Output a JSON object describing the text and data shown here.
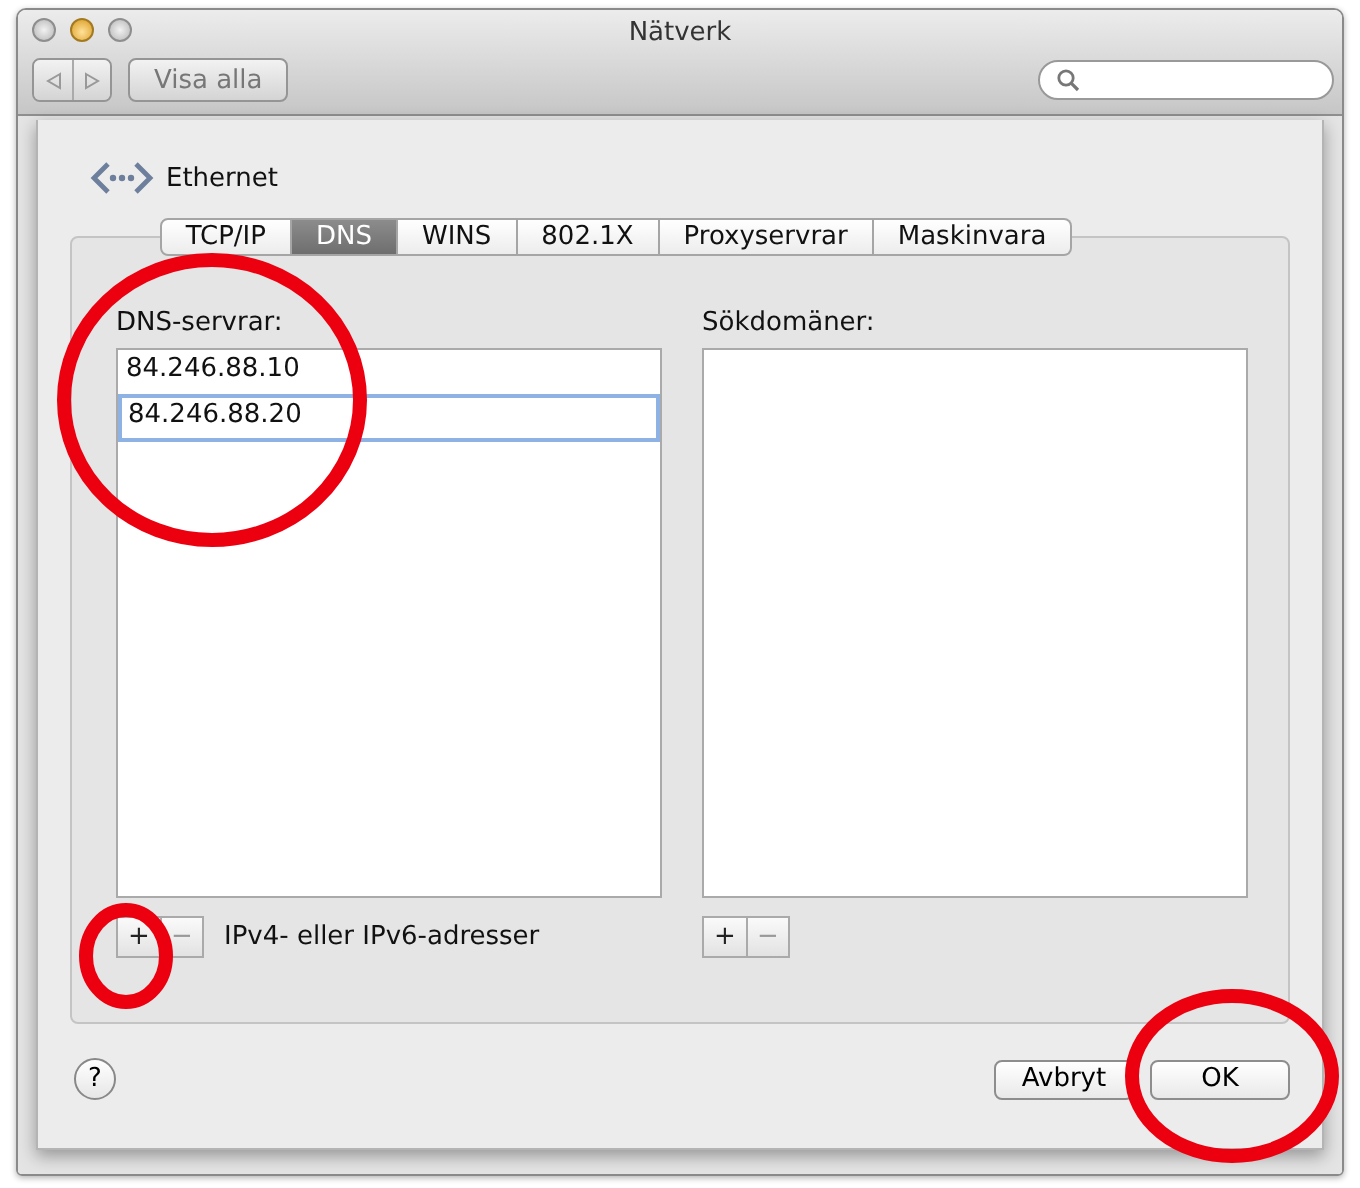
{
  "window": {
    "title": "Nätverk"
  },
  "toolbar": {
    "show_all": "Visa alla"
  },
  "sheet": {
    "interface": "Ethernet",
    "tabs": [
      {
        "label": "TCP/IP",
        "selected": false
      },
      {
        "label": "DNS",
        "selected": true
      },
      {
        "label": "WINS",
        "selected": false
      },
      {
        "label": "802.1X",
        "selected": false
      },
      {
        "label": "Proxyservrar",
        "selected": false
      },
      {
        "label": "Maskinvara",
        "selected": false
      }
    ],
    "dns_servers": {
      "label": "DNS-servrar:",
      "entries": [
        {
          "value": "84.246.88.10",
          "selected": false
        },
        {
          "value": "84.246.88.20",
          "selected": true
        }
      ],
      "add": "+",
      "remove": "−",
      "hint": "IPv4- eller IPv6-adresser"
    },
    "search_domains": {
      "label": "Sökdomäner:",
      "add": "+",
      "remove": "−"
    },
    "help": "?",
    "buttons": [
      "Avbryt",
      "OK"
    ]
  },
  "annotations": [
    {
      "kind": "circle"
    },
    {
      "kind": "circle"
    },
    {
      "kind": "circle"
    }
  ]
}
